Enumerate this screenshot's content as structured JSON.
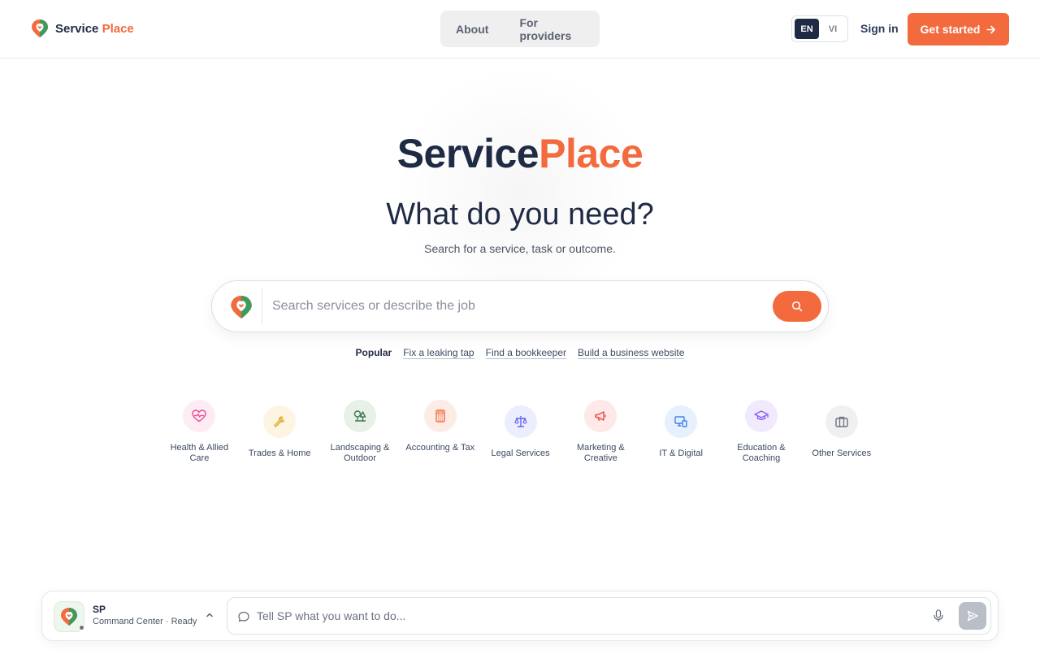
{
  "header": {
    "brand_main": "Service",
    "brand_accent": "Place",
    "nav": [
      "About",
      "For providers"
    ],
    "lang_options": [
      "EN",
      "VI"
    ],
    "lang_selected": "EN",
    "sign_in": "Sign in",
    "cta": "Get started"
  },
  "hero": {
    "logo_main": "Service",
    "logo_accent": "Place",
    "title": "What do you need?",
    "subtitle": "Search for a service, task or outcome.",
    "search_placeholder": "Search services or describe the job"
  },
  "popular": {
    "label": "Popular",
    "links": [
      "Fix a leaking tap",
      "Find a bookkeeper",
      "Build a business website"
    ]
  },
  "categories": [
    {
      "label": "Health & Allied Care",
      "icon": "heart-pulse-icon",
      "color": "#ec4899",
      "bg": "#fdecf3"
    },
    {
      "label": "Trades & Home",
      "icon": "hammer-icon",
      "color": "#e0a81f",
      "bg": "#fdf5e2"
    },
    {
      "label": "Landscaping & Outdoor",
      "icon": "trees-icon",
      "color": "#3f7a4c",
      "bg": "#e7f1e8"
    },
    {
      "label": "Accounting & Tax",
      "icon": "calculator-icon",
      "color": "#f26a3d",
      "bg": "#fdece5"
    },
    {
      "label": "Legal Services",
      "icon": "scale-icon",
      "color": "#6366f1",
      "bg": "#eceefd"
    },
    {
      "label": "Marketing & Creative",
      "icon": "megaphone-icon",
      "color": "#ef4444",
      "bg": "#fde9e7"
    },
    {
      "label": "IT & Digital",
      "icon": "devices-icon",
      "color": "#3b82f6",
      "bg": "#e7f0fd"
    },
    {
      "label": "Education & Coaching",
      "icon": "graduation-cap-icon",
      "color": "#8b5cf6",
      "bg": "#f1eafd"
    },
    {
      "label": "Other Services",
      "icon": "briefcase-icon",
      "color": "#6b7280",
      "bg": "#eff0f2"
    }
  ],
  "command_bar": {
    "name": "SP",
    "status": "Command Center · Ready",
    "placeholder": "Tell SP what you want to do..."
  },
  "colors": {
    "accent": "#f26a3d",
    "navy": "#1f2a44"
  }
}
